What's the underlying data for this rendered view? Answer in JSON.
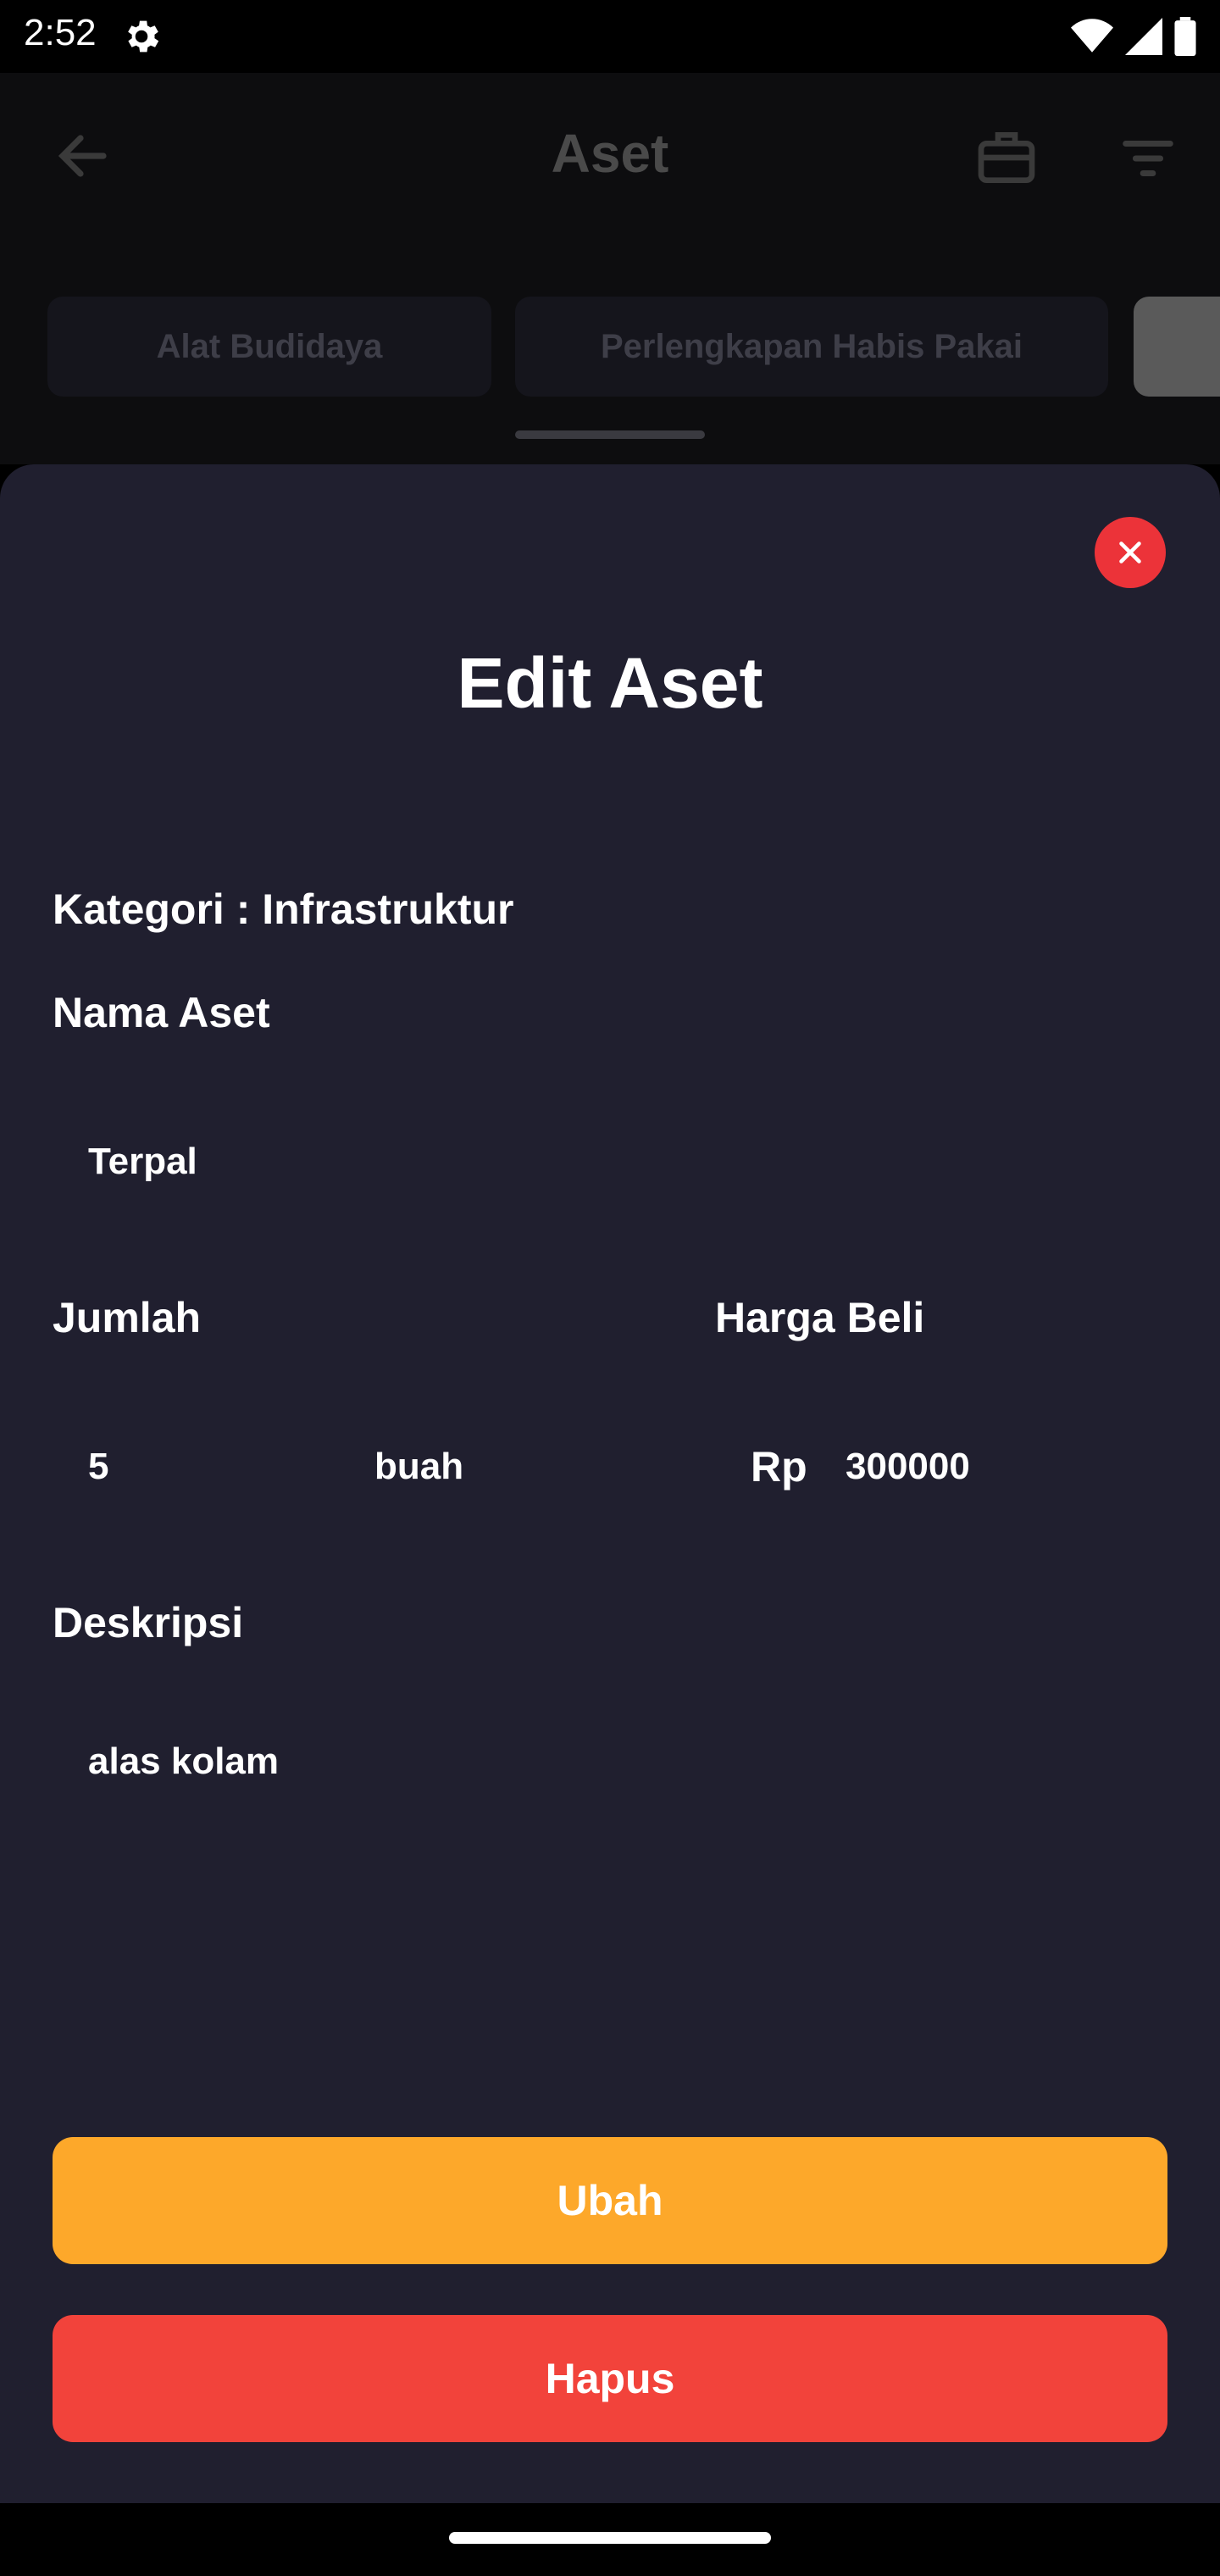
{
  "status": {
    "time": "2:52"
  },
  "appbar": {
    "title": "Aset"
  },
  "categories": [
    {
      "label": "Alat Budidaya"
    },
    {
      "label": "Perlengkapan Habis Pakai"
    },
    {
      "label": ""
    }
  ],
  "sheet": {
    "title": "Edit Aset",
    "category_text": "Kategori : Infrastruktur",
    "name_label": "Nama Aset",
    "name_value": "Terpal",
    "qty_label": "Jumlah",
    "qty_value": "5",
    "unit_value": "buah",
    "price_label": "Harga Beli",
    "currency": "Rp",
    "price_value": "300000",
    "desc_label": "Deskripsi",
    "desc_value": "alas kolam",
    "update_label": "Ubah",
    "delete_label": "Hapus"
  },
  "colors": {
    "sheet_bg": "#201f2f",
    "update_button": "#fda82a",
    "delete_button": "#f2433b",
    "close_button": "#ec3339"
  },
  "icons": {
    "back": "arrow-left-icon",
    "briefcase": "briefcase-icon",
    "filter": "filter-icon",
    "close": "close-icon",
    "settings": "gear-icon"
  }
}
